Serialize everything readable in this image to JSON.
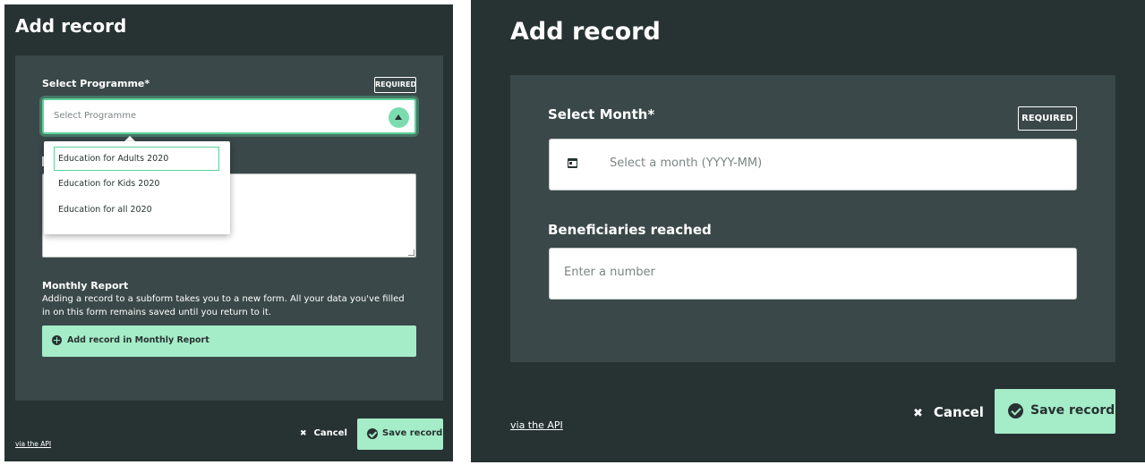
{
  "left_dialog": {
    "title": "Add record",
    "programme_label": "Select Programme*",
    "required_badge": "REQUIRED",
    "select_placeholder": "Select Programme",
    "dropdown_options": [
      "Education for Adults 2020",
      "Education for Kids 2020",
      "Education for all 2020"
    ],
    "monthly_report_heading": "Monthly Report",
    "monthly_report_description": "Adding a record to a subform takes you to a new form. All your data you've filled in on this form remains saved until you return to it.",
    "add_subrecord_label": "Add record in Monthly Report",
    "api_link": "via the API",
    "cancel_label": "Cancel",
    "save_label": "Save record"
  },
  "right_dialog": {
    "title": "Add record",
    "month_label": "Select Month*",
    "required_badge": "REQUIRED",
    "month_placeholder": "Select a month (YYYY-MM)",
    "beneficiaries_label": "Beneficiaries reached",
    "number_placeholder": "Enter a number",
    "api_link": "via the API",
    "cancel_label": "Cancel",
    "save_label": "Save record"
  },
  "icons": {
    "select_toggle": "chevron-up-icon",
    "add": "plus-circle-icon",
    "cancel": "close-icon",
    "save": "check-circle-icon",
    "calendar": "calendar-icon"
  },
  "colors": {
    "background": "#273232",
    "card": "#3a4849",
    "accent": "#a5ecc8",
    "focus_border": "#5ed19a"
  }
}
